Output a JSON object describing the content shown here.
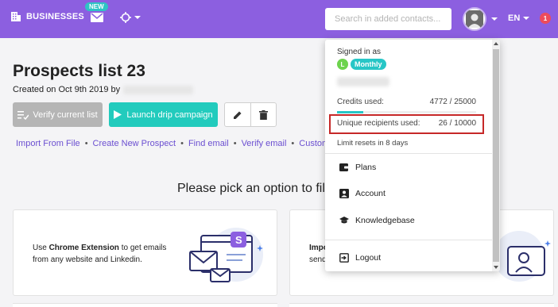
{
  "topbar": {
    "businesses_label": "BUSINESSES",
    "new_badge": "NEW",
    "search_placeholder": "Search in added contacts...",
    "language": "EN",
    "notification_count": "1",
    "brand_color": "#8c5fe0"
  },
  "page": {
    "title": "Prospects list 23",
    "created_prefix": "Created on Oct 9th 2019 by",
    "verify_button": "Verify current list",
    "drip_button": "Launch drip campaign",
    "links": [
      "Import From File",
      "Create New Prospect",
      "Find email",
      "Verify email",
      "Custom"
    ],
    "pick_text": "Please pick an option to fil"
  },
  "cards": [
    {
      "prefix": "Use ",
      "bold": "Chrome Extension",
      "rest": " to get emails from any website and Linkedin."
    },
    {
      "prefix": "Impo",
      "rest": "send"
    }
  ],
  "dropdown": {
    "signed_in_as": "Signed in as",
    "plan_letter": "L",
    "plan_name": "Monthly",
    "credits_label": "Credits used:",
    "credits_value": "4772 / 25000",
    "credits_fraction": 0.19,
    "unique_label": "Unique recipients used:",
    "unique_value": "26 / 10000",
    "limit_reset": "Limit resets in 8 days",
    "items": [
      {
        "label": "Plans",
        "icon": "wallet-icon"
      },
      {
        "label": "Account",
        "icon": "account-icon"
      },
      {
        "label": "Knowledgebase",
        "icon": "graduation-cap-icon"
      },
      {
        "label": "Logout",
        "icon": "logout-icon"
      }
    ]
  }
}
